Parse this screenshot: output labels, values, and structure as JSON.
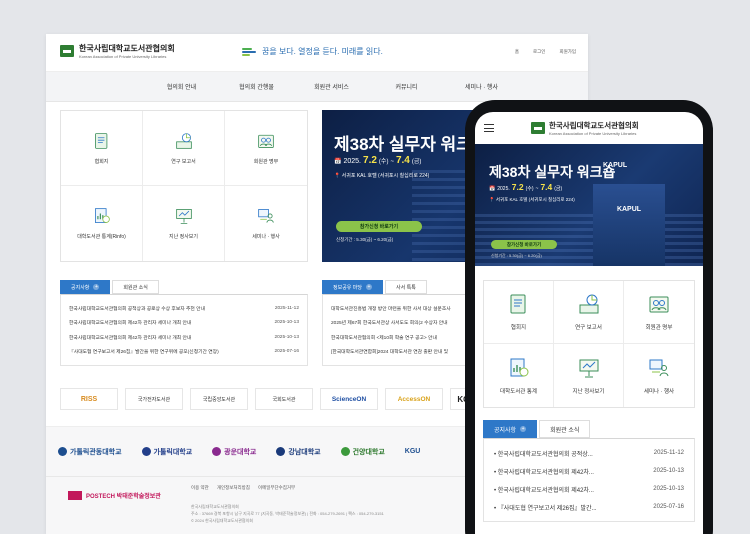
{
  "desktop": {
    "logo": {
      "kr": "한국사립대학교도서관협의회",
      "en": "Korean Association of Private University Libraries"
    },
    "slogan": "꿈을 보다. 열정을 듣다. 미래를 읽다.",
    "util": [
      "홈",
      "로그인",
      "회원가입"
    ],
    "gnb": [
      "협의회 안내",
      "협의회 간행물",
      "회원관 서비스",
      "커뮤니티",
      "세미나 · 행사"
    ],
    "quick": [
      "협회지",
      "연구 보고서",
      "회원관 명부",
      "대학도서관 통계(Rinfo)",
      "지난 정사보기",
      "세미나 · 행사"
    ],
    "banner": {
      "title": "제38차 실무자 워크숍",
      "year": "2025.",
      "date_start": "7.2",
      "dow_start": "(수)",
      "sep": " ~ ",
      "date_end": "7.4",
      "dow_end": "(금)",
      "place": "서귀포 KAL 호텔 (서귀포시 칠십리로 224)",
      "button": "참가신청 바로가기",
      "period": "신청기간 : 5.30(금) ~ 6.20(금)"
    },
    "news_tabs": [
      "공지사항",
      "회원관 소식"
    ],
    "news": [
      {
        "title": "한국사립대학교도서관협의회 공적상과 공로상 수상 후보자 추천 안내",
        "date": "2025-11-12"
      },
      {
        "title": "한국사립대학교도서관협의회 제42차 관리자 세미나 개최 안내",
        "date": "2025-10-13"
      },
      {
        "title": "한국사립대학교도서관협의회 제42차 관리자 세미나 개최 안내",
        "date": "2025-10-13"
      },
      {
        "title": "『사대도협 연구보고서 제26집』발간을 위한 연구위에 공모(신청기간 연장)",
        "date": "2025-07-16"
      }
    ],
    "news2_tabs": [
      "정보공유 마당",
      "사서 특톡"
    ],
    "news2": [
      "대학도서관진흥법 개정 방안 마련을 위한 사서 대상 설문조사",
      "2025년 제67회 한국도서관상 사서도도 회의(2 수상자 안내",
      "한국대학도서관협의회 <제10회 학술 연구 공고> 안내",
      "[한국대학도서관연합회]2024 대학도서관 연감 출판 안내 및"
    ],
    "partners": [
      "RISS",
      "국가전자도서관",
      "국립중앙도서관",
      "국회도서관",
      "ScienceON",
      "AccessON",
      "KOCW"
    ],
    "footer_logos": [
      "가톨릭관동대학교",
      "가톨릭대학교",
      "광운대학교",
      "강남대학교",
      "건양대학교",
      "KGU"
    ],
    "footer_postech": "POSTECH 박태준학술정보관",
    "footer_links": [
      "이용 약관",
      "개인정보처리방침",
      "이메일무단수집거부"
    ],
    "footer_addr": [
      "한국사립대학교도서관협의회",
      "주소 : 37669 경북 포항시 남구 지곡로 77 (지곡동, 박태준학술정보관) | 전화 : 054-279-2691 | 팩스 : 054-279-3151",
      "© 2024 한국사립대학교도서관협의회"
    ]
  },
  "mobile": {
    "logo": {
      "kr": "한국사립대학교도서관협의회",
      "en": "Korean Association of Private University Libraries"
    },
    "banner": {
      "title": "제38차 실무자 워크숍",
      "year": "2025.",
      "date_start": "7.2",
      "dow_start": "(수)",
      "sep": " ~ ",
      "date_end": "7.4",
      "dow_end": "(금)",
      "place": "서귀포 KAL 호텔 (서귀포시 칠십리로 224)",
      "button": "참가신청 바로가기",
      "period": "신청기간 : 5.30(금) ~ 6.20(금)",
      "podium_label": "KAPUL",
      "sign": "KAPUL"
    },
    "quick": [
      "협회지",
      "연구 보고서",
      "회원관 명부",
      "대학도서관 통계",
      "지난 정사보기",
      "세미나 · 행사"
    ],
    "news_tabs": [
      "공지사항",
      "회원관 소식"
    ],
    "news": [
      {
        "title": "한국사립대학교도서관협의회 공적상...",
        "date": "2025-11-12"
      },
      {
        "title": "한국사립대학교도서관협의회 제42차...",
        "date": "2025-10-13"
      },
      {
        "title": "한국사립대학교도서관협의회 제42차...",
        "date": "2025-10-13"
      },
      {
        "title": "『사대도협 연구보고서 제26집』발간...",
        "date": "2025-07-16"
      }
    ]
  },
  "colors": {
    "accent_blue": "#2e78c8",
    "brand_green": "#2e7d32",
    "banner_navy": "#0d1f44",
    "button_green": "#8bc34a",
    "highlight_yellow": "#f7e34a"
  }
}
